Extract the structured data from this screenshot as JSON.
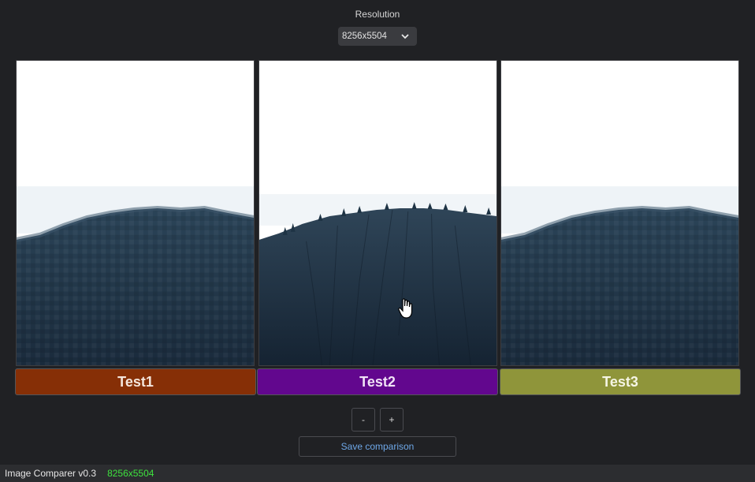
{
  "resolution": {
    "label": "Resolution",
    "selected": "8256x5504"
  },
  "panels": [
    {
      "label": "Test1",
      "color": "#862f06",
      "quality": "pixelated"
    },
    {
      "label": "Test2",
      "color": "#62078e",
      "quality": "sharp"
    },
    {
      "label": "Test3",
      "color": "#8f953a",
      "quality": "pixelated"
    }
  ],
  "controls": {
    "zoom_out_label": "-",
    "zoom_in_label": "+",
    "save_label": "Save comparison"
  },
  "status": {
    "app_name": "Image Comparer v0.3",
    "resolution": "8256x5504"
  },
  "icons": {
    "dropdown": "chevron-down-icon",
    "cursor": "hand-cursor-icon"
  }
}
